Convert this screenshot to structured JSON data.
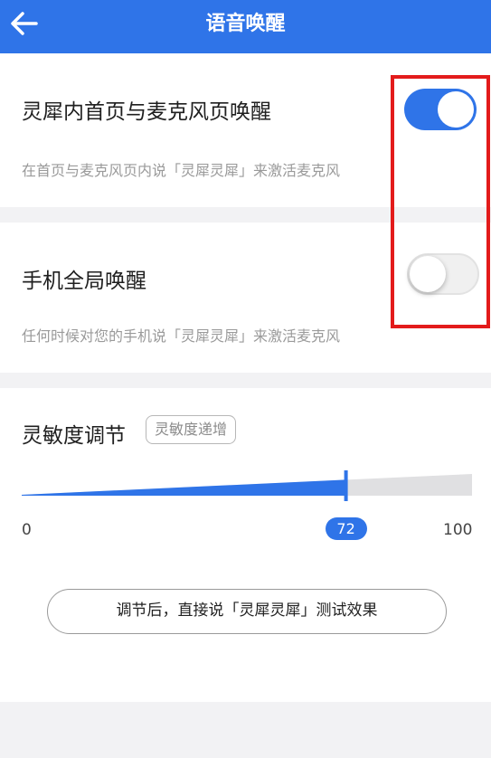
{
  "header": {
    "title": "语音唤醒",
    "back_icon": "arrow-left-icon"
  },
  "home_wakeup": {
    "title": "灵犀内首页与麦克风页唤醒",
    "description": "在首页与麦克风页内说「灵犀灵犀」来激活麦克风",
    "enabled": true
  },
  "global_wakeup": {
    "title": "手机全局唤醒",
    "description": "任何时候对您的手机说「灵犀灵犀」来激活麦克风",
    "enabled": false
  },
  "sensitivity": {
    "title": "灵敏度调节",
    "tag": "灵敏度递增",
    "min_label": "0",
    "max_label": "100",
    "value_label": "72",
    "value": 72,
    "min": 0,
    "max": 100
  },
  "test_button": {
    "label": "调节后，直接说「灵犀灵犀」测试效果"
  },
  "colors": {
    "accent": "#2f74e8",
    "highlight": "#e31b1b"
  }
}
